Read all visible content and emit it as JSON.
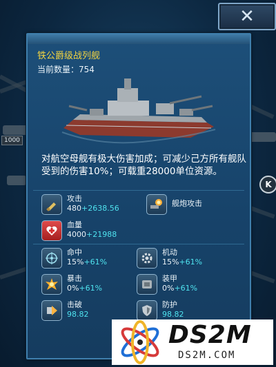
{
  "panel": {
    "title": "铁公爵级战列舰",
    "count_text": "当前数量：754",
    "description": "对航空母舰有极大伤害加成；可减少己方所有舰队受到的伤害10%；可载重28000单位资源。"
  },
  "side_tag": "1000",
  "close_label": "✕",
  "k_label": "K",
  "stats": {
    "attack": {
      "label": "攻击",
      "base": "480",
      "bonus": "+2638.56",
      "icon": "shell-icon"
    },
    "naval_gun": {
      "label": "舰炮攻击",
      "icon": "cannon-icon"
    },
    "hp": {
      "label": "血量",
      "base": "4000",
      "bonus": "+21988",
      "icon": "health-icon"
    },
    "hit": {
      "label": "命中",
      "base": "15%",
      "bonus": "+61%",
      "icon": "crosshair-icon"
    },
    "mobility": {
      "label": "机动",
      "base": "15%",
      "bonus": "+61%",
      "icon": "gear-icon"
    },
    "crit": {
      "label": "暴击",
      "base": "0%",
      "bonus": "+61%",
      "icon": "explosion-icon"
    },
    "armor": {
      "label": "装甲",
      "base": "0%",
      "bonus": "+61%",
      "icon": "armor-icon"
    },
    "pierce": {
      "label": "击破",
      "value": "98.82",
      "icon": "pierce-icon"
    },
    "defense": {
      "label": "防护",
      "value": "98.82",
      "icon": "shield-icon"
    }
  },
  "watermark": {
    "brand": "DS2M",
    "site": "DS2M.COM"
  },
  "colors": {
    "title": "#f2d441",
    "bonus": "#4fe3ef",
    "panel": "#1d4f79"
  }
}
